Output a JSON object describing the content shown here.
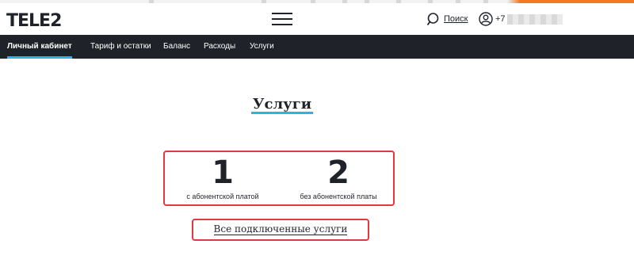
{
  "header": {
    "logo": "TELE2",
    "search_label": "Поиск",
    "phone_prefix": "+7 9"
  },
  "nav": {
    "items": [
      {
        "label": "Личный кабинет",
        "active": true
      },
      {
        "label": "Тариф и остатки",
        "active": false
      },
      {
        "label": "Баланс",
        "active": false
      },
      {
        "label": "Расходы",
        "active": false
      },
      {
        "label": "Услуги",
        "active": false
      }
    ]
  },
  "main": {
    "title": "Услуги",
    "counters": [
      {
        "value": "1",
        "caption": "с абонентской платой"
      },
      {
        "value": "2",
        "caption": "без абонентской платы"
      }
    ],
    "all_services_link": "Все подключенные услуги"
  },
  "colors": {
    "dark": "#1f2229",
    "accent_blue": "#2bb3e6",
    "highlight_red": "#e2383f"
  },
  "icons": [
    "menu-icon",
    "search-icon",
    "user-icon"
  ]
}
